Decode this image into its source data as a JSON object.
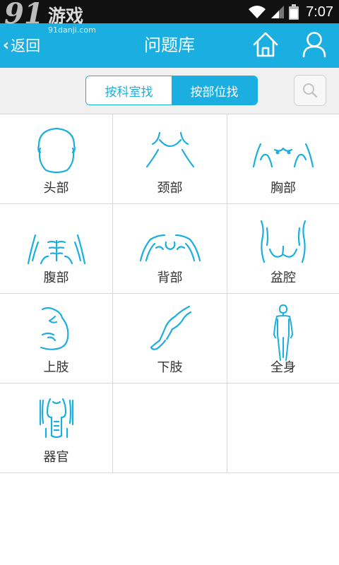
{
  "watermark": {
    "logo_number": "91",
    "logo_text": "游戏",
    "url": "91danji.com"
  },
  "status_bar": {
    "time": "7:07"
  },
  "nav": {
    "back_label": "返回",
    "title": "问题库"
  },
  "filter": {
    "tabs": [
      {
        "label": "按科室找",
        "active": false
      },
      {
        "label": "按部位找",
        "active": true
      }
    ]
  },
  "body_parts": [
    {
      "label": "头部",
      "icon": "head-icon"
    },
    {
      "label": "颈部",
      "icon": "neck-icon"
    },
    {
      "label": "胸部",
      "icon": "chest-icon"
    },
    {
      "label": "腹部",
      "icon": "abdomen-icon"
    },
    {
      "label": "背部",
      "icon": "back-icon"
    },
    {
      "label": "盆腔",
      "icon": "pelvis-icon"
    },
    {
      "label": "上肢",
      "icon": "arm-icon"
    },
    {
      "label": "下肢",
      "icon": "leg-icon"
    },
    {
      "label": "全身",
      "icon": "full-body-icon"
    },
    {
      "label": "器官",
      "icon": "organs-icon"
    }
  ],
  "colors": {
    "accent": "#1aafe0",
    "status_bar": "#111111",
    "filter_bg": "#f0f0f0",
    "grid_line": "#d8d8d8",
    "label_text": "#333333"
  }
}
